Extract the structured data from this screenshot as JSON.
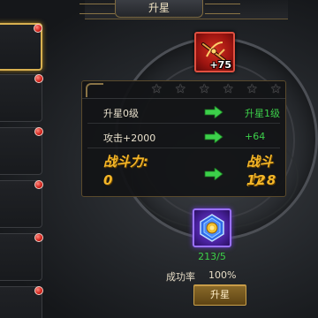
{
  "header": {
    "title": "升星"
  },
  "list": {
    "slots": [
      {
        "selected": true,
        "has_notification": true
      },
      {
        "selected": false,
        "has_notification": true
      },
      {
        "selected": false,
        "has_notification": true
      },
      {
        "selected": false,
        "has_notification": true
      },
      {
        "selected": false,
        "has_notification": true
      },
      {
        "selected": false,
        "has_notification": true
      }
    ]
  },
  "equipment": {
    "icon": "red-crossbow-icon",
    "level": "+75"
  },
  "panel": {
    "stars_total": 6,
    "stars_filled": 0,
    "rows": [
      {
        "label": "升星0级",
        "value": "升星1级"
      },
      {
        "label": "攻击+2000",
        "value": "+64"
      }
    ],
    "power": {
      "label_before": "战斗力:",
      "value_before": "0",
      "label_after": "战斗力:",
      "value_after": "128"
    }
  },
  "material": {
    "icon": "purple-gem-icon",
    "count": "213/5"
  },
  "success": {
    "label": "成功率",
    "value": "100%"
  },
  "action_button": {
    "label": "升星"
  },
  "colors": {
    "accent_gold": "#f4b628",
    "positive_green": "#3cd04a",
    "notification_red": "#d02018",
    "selection_gold": "#d8b050"
  }
}
